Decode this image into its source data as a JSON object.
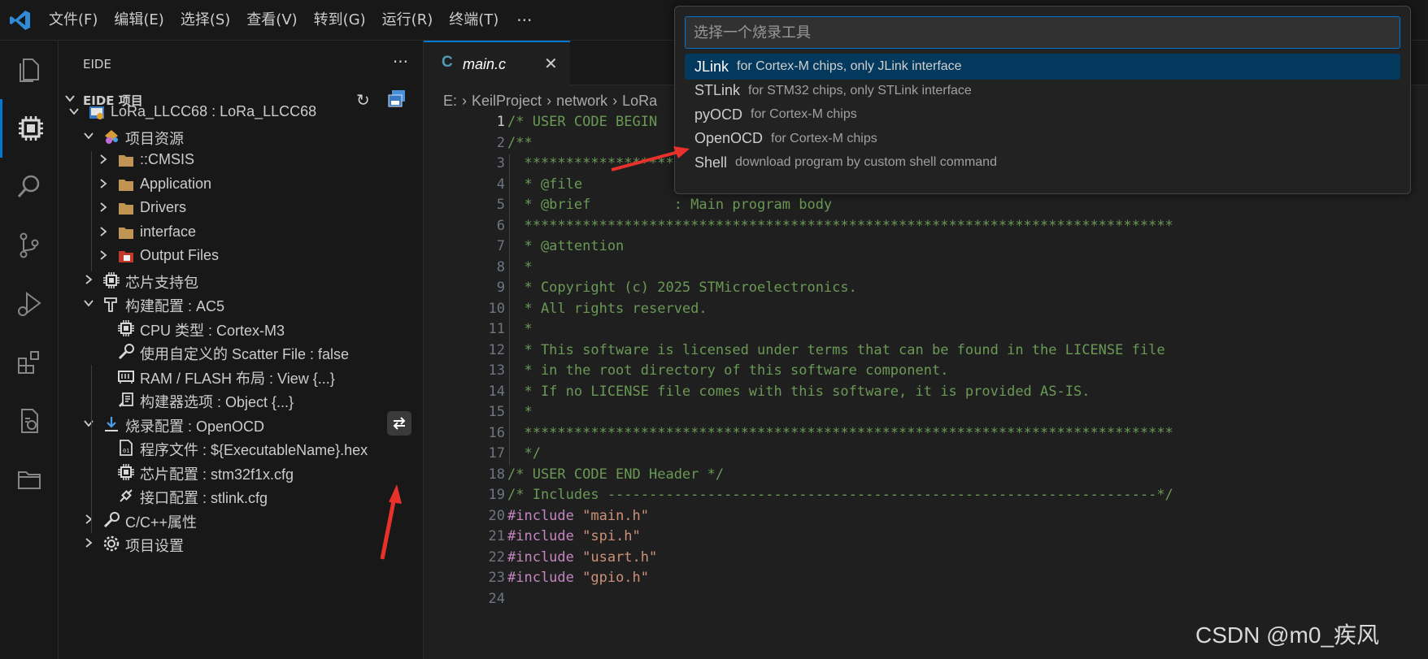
{
  "menubar": {
    "items": [
      "文件(F)",
      "编辑(E)",
      "选择(S)",
      "查看(V)",
      "转到(G)",
      "运行(R)",
      "终端(T)"
    ],
    "more": "···"
  },
  "activitybar": {
    "icons": [
      "explorer-icon",
      "eide-chip-icon",
      "search-icon",
      "source-control-icon",
      "run-debug-icon",
      "extensions-icon",
      "remote-icon",
      "folders-icon"
    ]
  },
  "sidebar": {
    "title": "EIDE",
    "more": "···",
    "section_title": "EIDE 项目",
    "tree": [
      {
        "label": "LoRa_LLCC68 : LoRa_LLCC68",
        "icon": "project-icon"
      },
      {
        "label": "项目资源",
        "icon": "resources-icon"
      },
      {
        "label": "::CMSIS",
        "icon": "folder-icon"
      },
      {
        "label": "Application",
        "icon": "folder-icon"
      },
      {
        "label": "Drivers",
        "icon": "folder-icon"
      },
      {
        "label": "interface",
        "icon": "folder-icon"
      },
      {
        "label": "Output Files",
        "icon": "output-folder-icon"
      },
      {
        "label": "芯片支持包",
        "icon": "chip-icon"
      },
      {
        "label": "构建配置 : AC5",
        "icon": "hammer-icon"
      },
      {
        "label": "CPU 类型 : Cortex-M3",
        "icon": "chip-icon"
      },
      {
        "label": "使用自定义的 Scatter File : false",
        "icon": "wrench-icon"
      },
      {
        "label": "RAM / FLASH 布局 : View {...}",
        "icon": "memory-icon"
      },
      {
        "label": "构建器选项 : Object {...}",
        "icon": "settings-list-icon"
      },
      {
        "label": "烧录配置 : OpenOCD",
        "icon": "download-icon"
      },
      {
        "label": "程序文件 : ${ExecutableName}.hex",
        "icon": "binary-file-icon"
      },
      {
        "label": "芯片配置 : stm32f1x.cfg",
        "icon": "chip-icon"
      },
      {
        "label": "接口配置 : stlink.cfg",
        "icon": "plug-icon"
      },
      {
        "label": "C/C++属性",
        "icon": "wrench-icon"
      },
      {
        "label": "项目设置",
        "icon": "gear-icon"
      }
    ]
  },
  "editor": {
    "tab": {
      "icon_text": "C",
      "label": "main.c",
      "close": "✕"
    },
    "breadcrumb": [
      "E:",
      "KeilProject",
      "network",
      "LoRa"
    ],
    "lines": [
      [
        {
          "t": "/* USER CODE BEGIN",
          "c": "cmt"
        }
      ],
      [
        {
          "t": "/**",
          "c": "cmt"
        }
      ],
      [
        {
          "t": "  ******************************************************************************",
          "c": "cmt"
        }
      ],
      [
        {
          "t": "  * @file           : main.c",
          "c": "cmt"
        }
      ],
      [
        {
          "t": "  * @brief          : Main program body",
          "c": "cmt"
        }
      ],
      [
        {
          "t": "  ******************************************************************************",
          "c": "cmt"
        }
      ],
      [
        {
          "t": "  * @attention",
          "c": "cmt"
        }
      ],
      [
        {
          "t": "  *",
          "c": "cmt"
        }
      ],
      [
        {
          "t": "  * Copyright (c) 2025 STMicroelectronics.",
          "c": "cmt"
        }
      ],
      [
        {
          "t": "  * All rights reserved.",
          "c": "cmt"
        }
      ],
      [
        {
          "t": "  *",
          "c": "cmt"
        }
      ],
      [
        {
          "t": "  * This software is licensed under terms that can be found in the LICENSE file",
          "c": "cmt"
        }
      ],
      [
        {
          "t": "  * in the root directory of this software component.",
          "c": "cmt"
        }
      ],
      [
        {
          "t": "  * If no LICENSE file comes with this software, it is provided AS-IS.",
          "c": "cmt"
        }
      ],
      [
        {
          "t": "  *",
          "c": "cmt"
        }
      ],
      [
        {
          "t": "  ******************************************************************************",
          "c": "cmt"
        }
      ],
      [
        {
          "t": "  */",
          "c": "cmt"
        }
      ],
      [
        {
          "t": "/* USER CODE END Header */",
          "c": "cmt"
        }
      ],
      [
        {
          "t": "/* Includes ------------------------------------------------------------------*/",
          "c": "cmt"
        }
      ],
      [
        {
          "t": "#include ",
          "c": "kw"
        },
        {
          "t": "\"main.h\"",
          "c": "str"
        }
      ],
      [
        {
          "t": "#include ",
          "c": "kw"
        },
        {
          "t": "\"spi.h\"",
          "c": "str"
        }
      ],
      [
        {
          "t": "#include ",
          "c": "kw"
        },
        {
          "t": "\"usart.h\"",
          "c": "str"
        }
      ],
      [
        {
          "t": "#include ",
          "c": "kw"
        },
        {
          "t": "\"gpio.h\"",
          "c": "str"
        }
      ],
      [
        {
          "t": "",
          "c": "cmt"
        }
      ]
    ]
  },
  "quickpick": {
    "placeholder": "选择一个烧录工具",
    "items": [
      {
        "label": "JLink",
        "description": "for Cortex-M chips, only JLink interface"
      },
      {
        "label": "STLink",
        "description": "for STM32 chips, only STLink interface"
      },
      {
        "label": "pyOCD",
        "description": "for Cortex-M chips"
      },
      {
        "label": "OpenOCD",
        "description": "for Cortex-M chips"
      },
      {
        "label": "Shell",
        "description": "download program by custom shell command"
      }
    ],
    "selected_index": 0
  },
  "watermark": "CSDN @m0_疾风",
  "colors": {
    "accent": "#0078d4",
    "annotation_arrow": "#e8312a"
  }
}
